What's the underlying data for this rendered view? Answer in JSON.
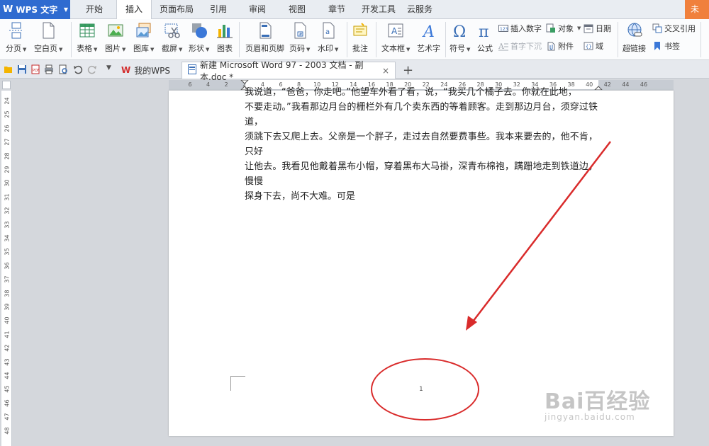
{
  "app": {
    "name": "WPS 文字",
    "logo_letter": "W"
  },
  "menu_tabs": [
    "开始",
    "插入",
    "页面布局",
    "引用",
    "审阅",
    "视图",
    "章节",
    "开发工具",
    "云服务"
  ],
  "menu_right_partial": "未",
  "ribbon": {
    "page_break": "分页",
    "blank_page": "空白页",
    "table": "表格",
    "picture": "图片",
    "gallery": "图库",
    "screenshot": "截屏",
    "shape": "形状",
    "chart": "图表",
    "header_footer": "页眉和页脚",
    "page_number": "页码",
    "watermark": "水印",
    "comment": "批注",
    "text_box": "文本框",
    "word_art": "艺术字",
    "symbol": "符号",
    "formula": "公式",
    "insert_number": "插入数字",
    "drop_cap": "首字下沉",
    "object": "对象",
    "attachment": "附件",
    "date": "日期",
    "field": "域",
    "hyperlink": "超链接",
    "cross_reference": "交叉引用",
    "bookmark": "书签"
  },
  "tabs": {
    "home": "我的WPS",
    "document": "新建 Microsoft Word 97 - 2003 文档 - 副本.doc *"
  },
  "ruler": {
    "h_ticks": [
      "6",
      "4",
      "2",
      "2",
      "4",
      "6",
      "8",
      "10",
      "12",
      "14",
      "16",
      "18",
      "20",
      "22",
      "24",
      "26",
      "28",
      "30",
      "32",
      "34",
      "36",
      "38",
      "40",
      "42",
      "44",
      "46"
    ],
    "v_ticks": [
      "24",
      "25",
      "26",
      "27",
      "28",
      "29",
      "30",
      "31",
      "32",
      "33",
      "34",
      "35",
      "36",
      "37",
      "38",
      "39",
      "40",
      "41",
      "42",
      "43",
      "44",
      "45",
      "46",
      "47",
      "48"
    ]
  },
  "document": {
    "lines": [
      "我说道，“爸爸，你走吧。”他望车外看了看，说，“我买几个橘子去。你就在此地，",
      "不要走动。”我看那边月台的栅栏外有几个卖东西的等着顾客。走到那边月台，须穿过铁道，",
      "须跳下去又爬上去。父亲是一个胖子，走过去自然要费事些。我本来要去的，他不肯，只好",
      "让他去。我看见他戴着黑布小帽，穿着黑布大马褂，深青布棉袍，蹒跚地走到铁道边，慢慢",
      "探身下去，尚不大难。可是"
    ],
    "page_number": "1"
  },
  "watermark": {
    "brand": "Bai百经验",
    "url": "jingyan.baidu.com"
  },
  "colors": {
    "accent_blue": "#2f6bd0",
    "annotation_red": "#d92b2b",
    "orange": "#f0803c"
  }
}
